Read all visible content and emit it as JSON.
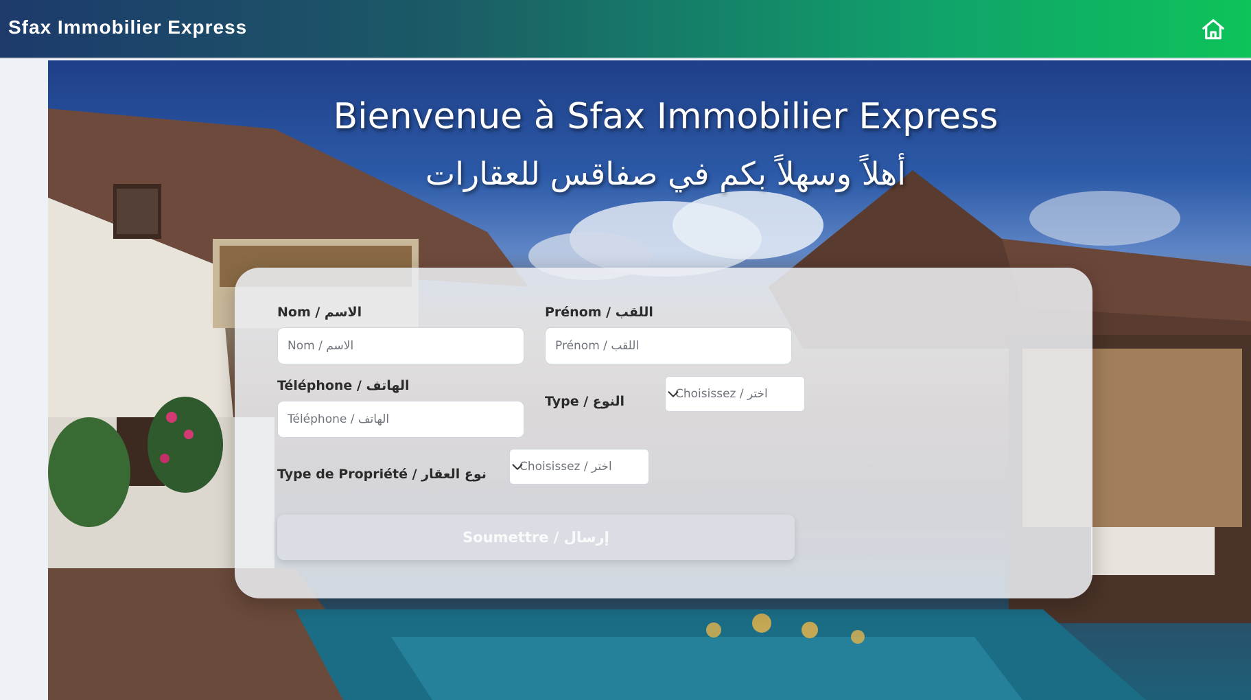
{
  "navbar": {
    "brand": "Sfax Immobilier Express",
    "home_icon": "home-icon"
  },
  "hero": {
    "title": "Bienvenue à Sfax Immobilier Express",
    "subtitle": "أهلاً وسهلاً بكم في صفاقس للعقارات"
  },
  "form": {
    "nom": {
      "label": "Nom / الاسم",
      "placeholder": "Nom / الاسم",
      "value": ""
    },
    "prenom": {
      "label": "Prénom / اللقب",
      "placeholder": "Prénom / اللقب",
      "value": ""
    },
    "telephone": {
      "label": "Téléphone / الهاتف",
      "placeholder": "Téléphone / الهاتف",
      "value": ""
    },
    "type": {
      "label": "Type / النوع",
      "selected": "Choisissez / اختر"
    },
    "property_type": {
      "label": "Type de Propriété / نوع العقار",
      "selected": "Choisissez / اختر"
    },
    "submit_label": "Soumettre / إرسال"
  },
  "colors": {
    "nav_start": "#1d3a6b",
    "nav_end": "#0ec35a"
  }
}
